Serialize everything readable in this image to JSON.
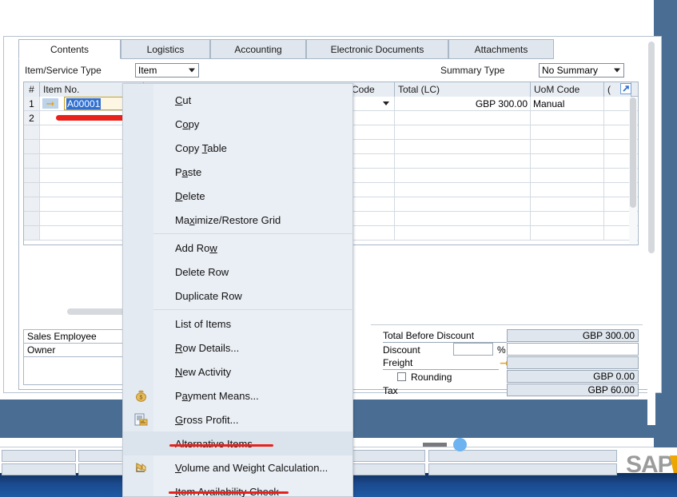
{
  "window": {
    "tabs": [
      {
        "label": "Contents",
        "active": true
      },
      {
        "label": "Logistics",
        "active": false
      },
      {
        "label": "Accounting",
        "active": false
      },
      {
        "label": "Electronic Documents",
        "active": false
      },
      {
        "label": "Attachments",
        "active": false
      }
    ]
  },
  "toolbar": {
    "item_service_type_label": "Item/Service Type",
    "item_service_type_value": "Item",
    "summary_type_label": "Summary Type",
    "summary_type_value": "No Summary"
  },
  "grid": {
    "columns": [
      {
        "key": "idx",
        "label": "#"
      },
      {
        "key": "item_no",
        "label": "Item No."
      },
      {
        "key": "code",
        "label": "Code"
      },
      {
        "key": "total_lc",
        "label": "Total (LC)"
      },
      {
        "key": "uom_code",
        "label": "UoM Code"
      },
      {
        "key": "partial",
        "label": "("
      }
    ],
    "rows": [
      {
        "idx": "1",
        "item_no": "A00001",
        "code": "",
        "total_lc": "GBP 300.00",
        "uom_code": "Manual",
        "partial": ""
      },
      {
        "idx": "2",
        "item_no": "",
        "code": "",
        "total_lc": "",
        "uom_code": "",
        "partial": ""
      }
    ]
  },
  "lower_left": {
    "rows": [
      {
        "label": "Sales Employee"
      },
      {
        "label": "Owner"
      }
    ]
  },
  "totals": {
    "total_before_discount_label": "Total Before Discount",
    "total_before_discount_value": "GBP 300.00",
    "discount_label": "Discount",
    "discount_value": "",
    "discount_pct_symbol": "%",
    "discount_amount_value": "",
    "freight_label": "Freight",
    "freight_value": "",
    "rounding_label": "Rounding",
    "rounding_value": "GBP 0.00",
    "tax_label": "Tax",
    "tax_value": "GBP 60.00"
  },
  "context_menu": {
    "items": [
      {
        "label": "Cut",
        "accel": "C",
        "icon": "",
        "highlighted": false,
        "underlined": false
      },
      {
        "label": "Copy",
        "accel": "o",
        "icon": "",
        "highlighted": false,
        "underlined": false
      },
      {
        "label": "Copy Table",
        "accel": "T",
        "icon": "",
        "highlighted": false,
        "underlined": false
      },
      {
        "label": "Paste",
        "accel": "a",
        "icon": "",
        "highlighted": false,
        "underlined": false
      },
      {
        "label": "Delete",
        "accel": "D",
        "icon": "",
        "highlighted": false,
        "underlined": false
      },
      {
        "label": "Maximize/Restore Grid",
        "accel": "x",
        "icon": "",
        "highlighted": false,
        "underlined": false
      },
      {
        "label": "Add Row",
        "accel": "w",
        "icon": "",
        "highlighted": false,
        "underlined": false
      },
      {
        "label": "Delete Row",
        "accel": "",
        "icon": "",
        "highlighted": false,
        "underlined": false
      },
      {
        "label": "Duplicate Row",
        "accel": "",
        "icon": "",
        "highlighted": false,
        "underlined": false
      },
      {
        "label": "List of Items",
        "accel": "",
        "icon": "",
        "highlighted": false,
        "underlined": false
      },
      {
        "label": "Row Details...",
        "accel": "R",
        "icon": "",
        "highlighted": false,
        "underlined": false
      },
      {
        "label": "New Activity",
        "accel": "N",
        "icon": "",
        "highlighted": false,
        "underlined": false
      },
      {
        "label": "Payment Means...",
        "accel": "y",
        "icon": "money-bag-icon",
        "highlighted": false,
        "underlined": false
      },
      {
        "label": "Gross Profit...",
        "accel": "G",
        "icon": "report-icon",
        "highlighted": false,
        "underlined": false
      },
      {
        "label": "Alternative Items",
        "accel": "",
        "icon": "",
        "highlighted": true,
        "underlined": true
      },
      {
        "label": "Volume and Weight Calculation...",
        "accel": "V",
        "icon": "scale-icon",
        "highlighted": false,
        "underlined": false
      },
      {
        "label": "Item Availability Check",
        "accel": "I",
        "icon": "",
        "highlighted": false,
        "underlined": true
      }
    ]
  },
  "branding": {
    "logo_text": "SAP"
  },
  "colors": {
    "accent_red": "#e8211a",
    "selection_blue": "#2f6fd0",
    "desktop_blue": "#4a6d94",
    "panel_blue": "#dfe6ee",
    "menu_bg": "#eaeff5",
    "menu_highlight": "#dbe3ed",
    "arrow_gold": "#e0a526",
    "sap_gray": "#9b9b9b"
  }
}
